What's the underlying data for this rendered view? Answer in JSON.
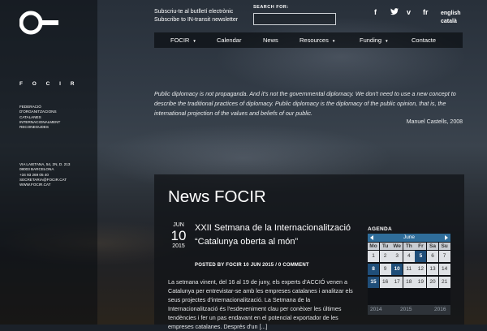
{
  "site": {
    "brand": "F O C I R",
    "org_name_lines": [
      "FEDERACIÓ",
      "D'ORGANITZACIONS",
      "CATALANES",
      "INTERNACIONALMENT",
      "RECONEGUDES"
    ],
    "address_lines": [
      "VIA LAIETANA, 54, 2N, D. 213",
      "08003 BARCELONA",
      "+34 93 269 05 40",
      "SECRETARIA@FOCIR.CAT",
      "WWW.FOCIR.CAT"
    ]
  },
  "header": {
    "subscribe_links": [
      "Subscriu-te al butlletí electrònic",
      "Subscribe to IN-transit newsletter"
    ],
    "search_label": "SEARCH FOR:",
    "search_value": "",
    "social": [
      {
        "icon": "facebook-icon",
        "glyph": "f"
      },
      {
        "icon": "twitter-icon",
        "glyph": "t"
      },
      {
        "icon": "vimeo-icon",
        "glyph": "v"
      },
      {
        "icon": "flickr-icon",
        "glyph": "fr"
      }
    ],
    "languages": [
      "english",
      "català"
    ]
  },
  "nav": {
    "items": [
      {
        "label": "FOCIR",
        "dropdown": true
      },
      {
        "label": "Calendar",
        "dropdown": false
      },
      {
        "label": "News",
        "dropdown": false
      },
      {
        "label": "Resources",
        "dropdown": true
      },
      {
        "label": "Funding",
        "dropdown": true
      },
      {
        "label": "Contacte",
        "dropdown": false
      }
    ]
  },
  "quote": {
    "text": "Public diplomacy is not propaganda. And it's not the governmental diplomacy. We don't need to use a new concept to describe the traditional practices of diplomacy. Public diplomacy is the diplomacy of the public opinion, that is, the international projection of the values and beliefs of our public.",
    "author": "Manuel Castells, 2008"
  },
  "news": {
    "heading": "News FOCIR",
    "post": {
      "month": "JUN",
      "day": "10",
      "year": "2015",
      "title": "XXII Setmana de la Internacionalització “Catalunya oberta al món”",
      "meta": "POSTED BY FOCIR 10 JUN 2015 / 0 COMMENT",
      "body": "La setmana vinent, del 16 al 19 de juny, els experts d'ACCIÓ venen a Catalunya per entrevistar-se amb les empreses catalanes i analitzar els seus projectes d'internacionalització. La Setmana de la Internacionalització és l'esdeveniment clau per conèixer les últimes tendències i fer un pas endavant en el potencial exportador de les empreses catalanes. Després d'un [...]"
    }
  },
  "agenda": {
    "title": "AGENDA",
    "month": "June",
    "weekdays": [
      "Mo",
      "Tu",
      "We",
      "Th",
      "Fr",
      "Sa",
      "Su"
    ],
    "weeks": [
      [
        "1",
        "2",
        "3",
        "4",
        "5",
        "6",
        "7"
      ],
      [
        "8",
        "9",
        "10",
        "11",
        "12",
        "13",
        "14"
      ],
      [
        "15",
        "16",
        "17",
        "18",
        "19",
        "20",
        "21"
      ]
    ],
    "event_days": [
      "5",
      "8",
      "10",
      "15"
    ],
    "years": [
      "2014",
      "2015",
      "2016"
    ]
  }
}
